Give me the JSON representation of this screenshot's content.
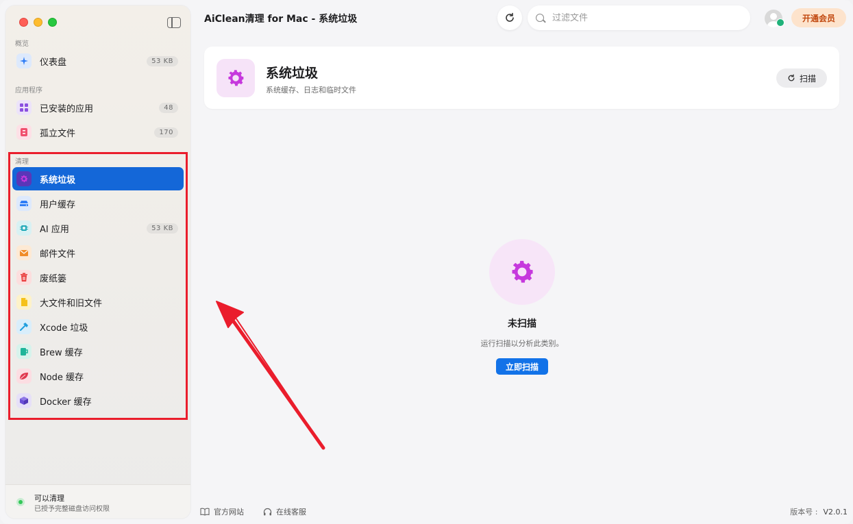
{
  "app": {
    "title": "AiClean清理 for Mac - 系统垃圾"
  },
  "search": {
    "placeholder": "过滤文件"
  },
  "vip_button": "开通会员",
  "sidebar": {
    "sections": [
      {
        "label": "概览"
      },
      {
        "label": "应用程序"
      },
      {
        "label": "清理"
      }
    ],
    "items": [
      {
        "label": "仪表盘",
        "badge": "53 KB",
        "icon": "sparkle-icon",
        "color": "#2f7df6"
      },
      {
        "label": "已安装的应用",
        "badge": "48",
        "icon": "apps-grid-icon",
        "color": "#8a4fe0"
      },
      {
        "label": "孤立文件",
        "badge": "170",
        "icon": "orphan-file-icon",
        "color": "#f0506e"
      },
      {
        "label": "系统垃圾",
        "badge": "",
        "icon": "gear-icon",
        "color": "#c639dd"
      },
      {
        "label": "用户缓存",
        "badge": "",
        "icon": "drive-icon",
        "color": "#2f7df6"
      },
      {
        "label": "AI 应用",
        "badge": "53 KB",
        "icon": "chip-icon",
        "color": "#1ea8b7"
      },
      {
        "label": "邮件文件",
        "badge": "",
        "icon": "mail-icon",
        "color": "#f08c28"
      },
      {
        "label": "废纸篓",
        "badge": "",
        "icon": "trash-icon",
        "color": "#ea3d3d"
      },
      {
        "label": "大文件和旧文件",
        "badge": "",
        "icon": "document-icon",
        "color": "#f5c11a"
      },
      {
        "label": "Xcode 垃圾",
        "badge": "",
        "icon": "hammer-icon",
        "color": "#1f9ede"
      },
      {
        "label": "Brew 缓存",
        "badge": "",
        "icon": "mug-icon",
        "color": "#1fb59a"
      },
      {
        "label": "Node 缓存",
        "badge": "",
        "icon": "leaf-icon",
        "color": "#e0384f"
      },
      {
        "label": "Docker 缓存",
        "badge": "",
        "icon": "box-icon",
        "color": "#6a4fd6"
      }
    ],
    "footer": {
      "title": "可以清理",
      "subtitle": "已授予完整磁盘访问权限"
    }
  },
  "header_card": {
    "title": "系统垃圾",
    "subtitle": "系统缓存、日志和临时文件",
    "scan_label": "扫描"
  },
  "empty_state": {
    "title": "未扫描",
    "subtitle": "运行扫描以分析此类别。",
    "button": "立即扫描"
  },
  "footer": {
    "website": "官方网站",
    "support": "在线客服",
    "version_label": "版本号 :",
    "version_value": "V2.0.1"
  },
  "colors": {
    "accent": "#1467d8",
    "annotation": "#ea1d2c",
    "system_junk": "#c639dd"
  }
}
